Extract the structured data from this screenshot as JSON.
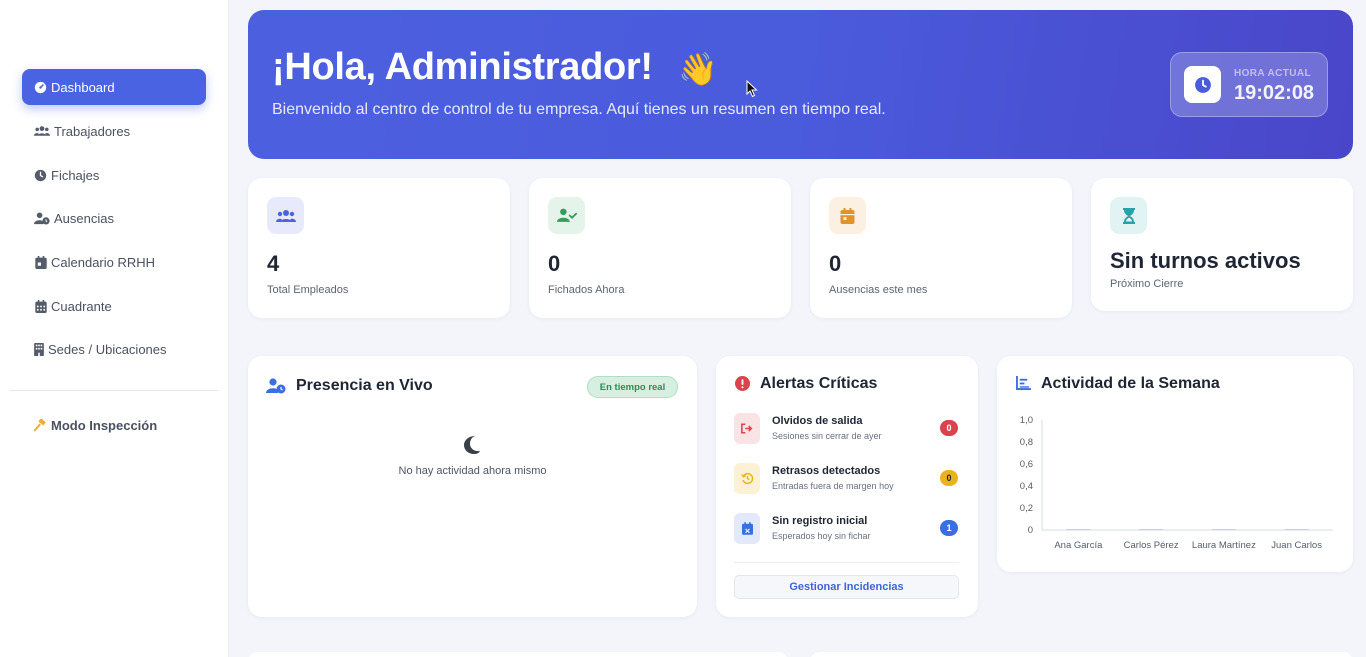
{
  "sidebar": {
    "items": [
      {
        "label": "Dashboard",
        "icon": "gauge-icon",
        "active": true
      },
      {
        "label": "Trabajadores",
        "icon": "users-icon"
      },
      {
        "label": "Fichajes",
        "icon": "clock-icon"
      },
      {
        "label": "Ausencias",
        "icon": "user-clock-icon"
      },
      {
        "label": "Calendario RRHH",
        "icon": "calendar-icon"
      },
      {
        "label": "Cuadrante",
        "icon": "grid-calendar-icon"
      },
      {
        "label": "Sedes / Ubicaciones",
        "icon": "building-icon"
      }
    ],
    "inspect_label": "Modo Inspección"
  },
  "hero": {
    "title": "¡Hola, Administrador!",
    "wave": "👋",
    "subtitle": "Bienvenido al centro de control de tu empresa. Aquí tienes un resumen en tiempo real.",
    "clock_label": "HORA ACTUAL",
    "clock_time": "19:02:08"
  },
  "stats": [
    {
      "value": "4",
      "label": "Total Empleados",
      "color": "#4a63e3"
    },
    {
      "value": "0",
      "label": "Fichados Ahora",
      "color": "#3a9a5b"
    },
    {
      "value": "0",
      "label": "Ausencias este mes",
      "color": "#e0922e"
    },
    {
      "value": "Sin turnos activos",
      "label": "Próximo Cierre",
      "color": "#2aa0a8"
    }
  ],
  "presence": {
    "title": "Presencia en Vivo",
    "badge": "En tiempo real",
    "empty": "No hay actividad ahora mismo"
  },
  "alerts": {
    "title": "Alertas Críticas",
    "items": [
      {
        "title": "Olvidos de salida",
        "subtitle": "Sesiones sin cerrar de ayer",
        "count": "0",
        "color": "#d9434b"
      },
      {
        "title": "Retrasos detectados",
        "subtitle": "Entradas fuera de margen hoy",
        "count": "0",
        "color": "#eab21f"
      },
      {
        "title": "Sin registro inicial",
        "subtitle": "Esperados hoy sin fichar",
        "count": "1",
        "color": "#3b6fe0"
      }
    ],
    "button": "Gestionar Incidencias"
  },
  "activity": {
    "title": "Actividad de la Semana"
  },
  "chart_data": {
    "type": "bar",
    "categories": [
      "Ana García",
      "Carlos Pérez",
      "Laura Martínez",
      "Juan Carlos"
    ],
    "values": [
      0,
      0,
      0,
      0
    ],
    "ylim": [
      0,
      1
    ],
    "yticks": [
      "0",
      "0,2",
      "0,4",
      "0,6",
      "0,8",
      "1,0"
    ],
    "grid": false
  }
}
